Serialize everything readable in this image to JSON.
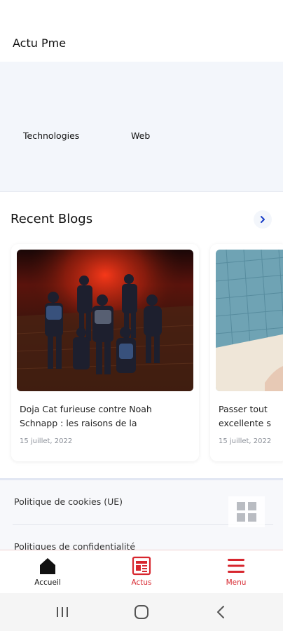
{
  "app": {
    "title": "Actu Pme"
  },
  "categories": [
    {
      "label": "Technologies"
    },
    {
      "label": "Web"
    }
  ],
  "recent_blogs": {
    "title": "Recent Blogs",
    "more_icon": "chevron-right-icon",
    "cards": [
      {
        "title_line1": "Doja Cat furieuse contre Noah",
        "title_line2": "Schnapp : les raisons de la",
        "date": "15 juillet, 2022"
      },
      {
        "title_line1": "Passer tout",
        "title_line2": "excellente s",
        "date": "15 juillet, 2022"
      }
    ]
  },
  "footer": {
    "links": [
      {
        "label": "Politique de cookies (UE)"
      },
      {
        "label": "Politiques de confidentialité"
      }
    ],
    "grid_icon": "grid-icon"
  },
  "bottom_nav": {
    "items": [
      {
        "label": "Accueil",
        "icon": "home-icon"
      },
      {
        "label": "Actus",
        "icon": "newspaper-icon"
      },
      {
        "label": "Menu",
        "icon": "hamburger-menu-icon"
      }
    ]
  },
  "colors": {
    "accent": "#d7262e",
    "chevron": "#1a3ec7",
    "band_background": "#f3f6fb"
  }
}
